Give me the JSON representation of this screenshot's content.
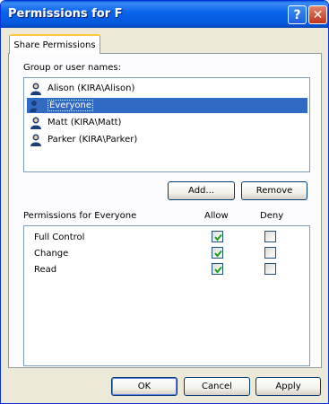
{
  "window": {
    "title": "Permissions for F"
  },
  "tabs": [
    {
      "label": "Share Permissions"
    }
  ],
  "group_section": {
    "label": "Group or user names:",
    "users": [
      {
        "label": "Alison (KIRA\\Alison)",
        "selected": false
      },
      {
        "label": "Everyone",
        "selected": true
      },
      {
        "label": "Matt (KIRA\\Matt)",
        "selected": false
      },
      {
        "label": "Parker (KIRA\\Parker)",
        "selected": false
      }
    ],
    "add_label": "Add...",
    "remove_label": "Remove"
  },
  "permissions": {
    "header_label": "Permissions for Everyone",
    "allow_header": "Allow",
    "deny_header": "Deny",
    "rows": [
      {
        "label": "Full Control",
        "allow": true,
        "deny": false
      },
      {
        "label": "Change",
        "allow": true,
        "deny": false
      },
      {
        "label": "Read",
        "allow": true,
        "deny": false
      }
    ]
  },
  "footer": {
    "ok_label": "OK",
    "cancel_label": "Cancel",
    "apply_label": "Apply"
  },
  "colors": {
    "selection": "#316ac5",
    "check": "#21a121",
    "titlebar": "#0a5ae0"
  }
}
